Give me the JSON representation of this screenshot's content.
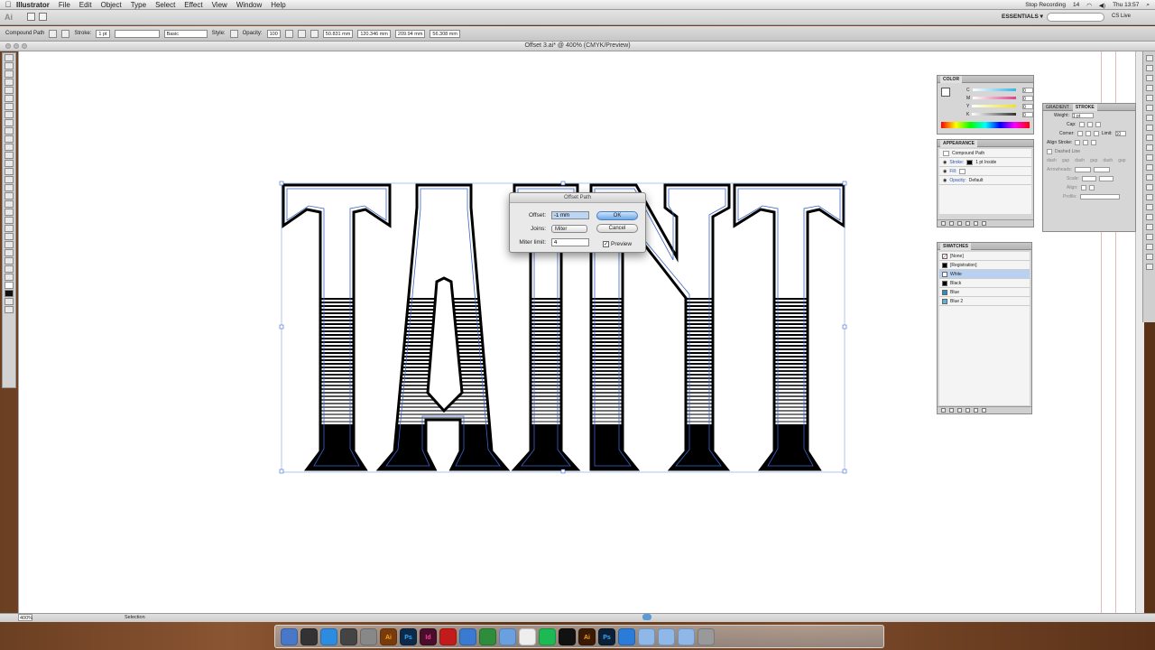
{
  "menubar": {
    "app_name": "Illustrator",
    "menus": [
      "File",
      "Edit",
      "Object",
      "Type",
      "Select",
      "Effect",
      "View",
      "Window",
      "Help"
    ],
    "stop_recording": "Stop Recording",
    "clock": "Thu 13:57",
    "battery_num": "14"
  },
  "appbar": {
    "logo": "Ai",
    "workspace": "ESSENTIALS ▾",
    "cslive": "CS Live"
  },
  "control": {
    "selection_type": "Compound Path",
    "stroke_label": "Stroke:",
    "stroke_value": "1 pt",
    "brush": "Basic",
    "style_label": "Style:",
    "opacity_label": "Opacity:",
    "opacity_value": "100",
    "x_value": "50.831 mm",
    "y_value": "120.346 mm",
    "w_value": "209.94 mm",
    "h_value": "56.308 mm"
  },
  "document": {
    "title": "Offset 3.ai* @ 400% (CMYK/Preview)",
    "zoom": "400%",
    "status_tool": "Selection"
  },
  "dialog": {
    "title": "Offset Path",
    "offset_label": "Offset:",
    "offset_value": "-1 mm",
    "joins_label": "Joins:",
    "joins_value": "Miter",
    "miter_label": "Miter limit:",
    "miter_value": "4",
    "preview_label": "Preview",
    "preview_checked": true,
    "ok_label": "OK",
    "cancel_label": "Cancel"
  },
  "color_panel": {
    "tab": "COLOR",
    "channels": [
      {
        "letter": "C",
        "value": "0",
        "color": "#33b5e5"
      },
      {
        "letter": "M",
        "value": "0",
        "color": "#e0408a"
      },
      {
        "letter": "Y",
        "value": "0",
        "color": "#f0e020"
      },
      {
        "letter": "K",
        "value": "0",
        "color": "#333333"
      }
    ]
  },
  "stroke_panel": {
    "tabs": [
      "GRADIENT",
      "STROKE"
    ],
    "weight_label": "Weight:",
    "weight_value": "1 pt",
    "cap_label": "Cap:",
    "corner_label": "Corner:",
    "limit_label": "Limit:",
    "limit_value": "10",
    "align_label": "Align Stroke:",
    "dashed_label": "Dashed Line",
    "dash_labels": [
      "dash",
      "gap",
      "dash",
      "gap",
      "dash",
      "gap"
    ],
    "arrowheads_label": "Arrowheads:",
    "scale_label": "Scale:",
    "align2_label": "Align:",
    "profile_label": "Profile:"
  },
  "appearance_panel": {
    "tab": "APPEARANCE",
    "title": "Compound Path",
    "rows": [
      {
        "label": "Stroke:",
        "value": "1 pt  Inside"
      },
      {
        "label": "Fill:",
        "value": ""
      },
      {
        "label": "Opacity:",
        "value": "Default"
      }
    ]
  },
  "swatches_panel": {
    "tab": "SWATCHES",
    "items": [
      {
        "name": "[None]",
        "color": "#ffffff"
      },
      {
        "name": "[Registration]",
        "color": "#000000"
      },
      {
        "name": "White",
        "color": "#ffffff"
      },
      {
        "name": "Black",
        "color": "#000000"
      },
      {
        "name": "Blue",
        "color": "#2a8ec1"
      },
      {
        "name": "Blue 2",
        "color": "#5ab3d6"
      }
    ]
  },
  "artwork": {
    "letters": [
      "T",
      "A",
      "I",
      "N",
      "T"
    ]
  },
  "dock": {
    "apps": [
      "Finder",
      "Dashboard",
      "App Store",
      "Mission Control",
      "Preview",
      "Ai",
      "Ps",
      "Id",
      "Acrobat",
      "Mail",
      "Chrome",
      "iTunes",
      "Calendar",
      "Spotify",
      "Sonos",
      "Ai",
      "Ps",
      "Safari"
    ]
  }
}
